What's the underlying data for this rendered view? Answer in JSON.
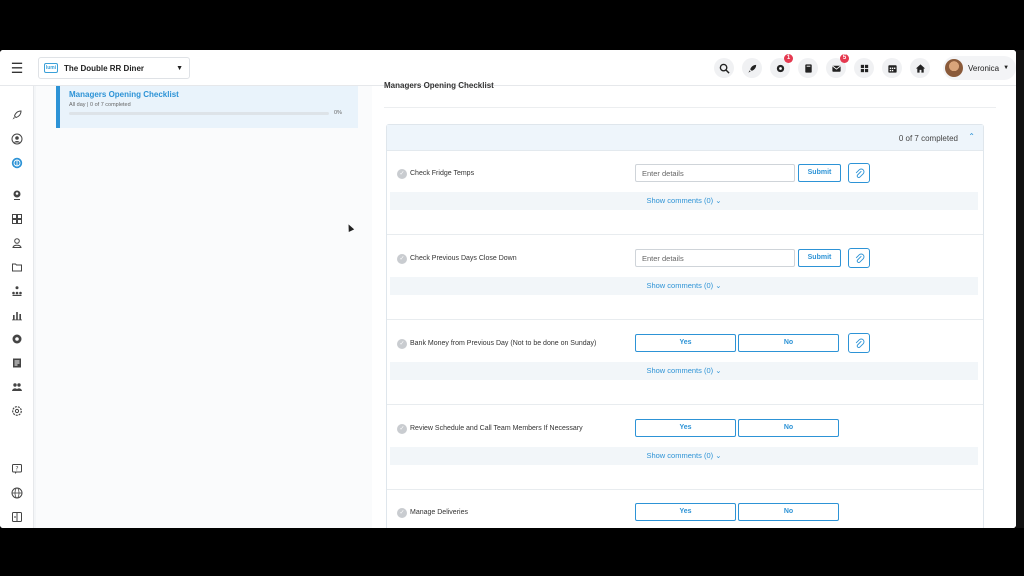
{
  "header": {
    "store_name": "The Double RR Diner",
    "store_logo_text": "lumi",
    "icons": [
      {
        "name": "search-icon"
      },
      {
        "name": "rocket-icon"
      },
      {
        "name": "notifications-icon",
        "badge": "1"
      },
      {
        "name": "book-icon"
      },
      {
        "name": "mail-icon",
        "badge": "5"
      },
      {
        "name": "apps-icon"
      },
      {
        "name": "calendar-icon"
      },
      {
        "name": "home-icon"
      }
    ],
    "user_name": "Veronica"
  },
  "sidebar": {
    "icons": [
      "rocket-icon",
      "user-circle-icon",
      "globe-active-icon",
      "person-pin-icon",
      "grid-icon",
      "user-icon",
      "folder-icon",
      "org-chart-icon",
      "bar-chart-icon",
      "gear-badge-icon",
      "schedule-icon",
      "team-icon",
      "settings-icon",
      "help-icon",
      "language-icon",
      "exit-icon"
    ]
  },
  "left_panel": {
    "checklist_title": "Managers Opening Checklist",
    "checklist_subtitle": "All day | 0 of 7 completed",
    "progress": 0,
    "progress_label": "0%"
  },
  "main": {
    "title": "Managers Opening Checklist",
    "completed_summary": "0 of 7 completed",
    "tasks": [
      {
        "label": "Check Fridge Temps",
        "type": "text",
        "placeholder": "Enter details",
        "submit_label": "Submit",
        "comments_label": "Show comments (0)"
      },
      {
        "label": "Check Previous Days Close Down",
        "type": "text",
        "placeholder": "Enter details",
        "submit_label": "Submit",
        "comments_label": "Show comments (0)"
      },
      {
        "label": "Bank Money from Previous Day (Not to be done on Sunday)",
        "type": "yesno",
        "yes_label": "Yes",
        "no_label": "No",
        "comments_label": "Show comments (0)"
      },
      {
        "label": "Review Schedule and Call Team Members If Necessary",
        "type": "yesno",
        "yes_label": "Yes",
        "no_label": "No",
        "comments_label": "Show comments (0)"
      },
      {
        "label": "Manage Deliveries",
        "type": "yesno",
        "yes_label": "Yes",
        "no_label": "No"
      }
    ]
  },
  "colors": {
    "accent": "#2d93d6",
    "badge": "#e53950"
  }
}
